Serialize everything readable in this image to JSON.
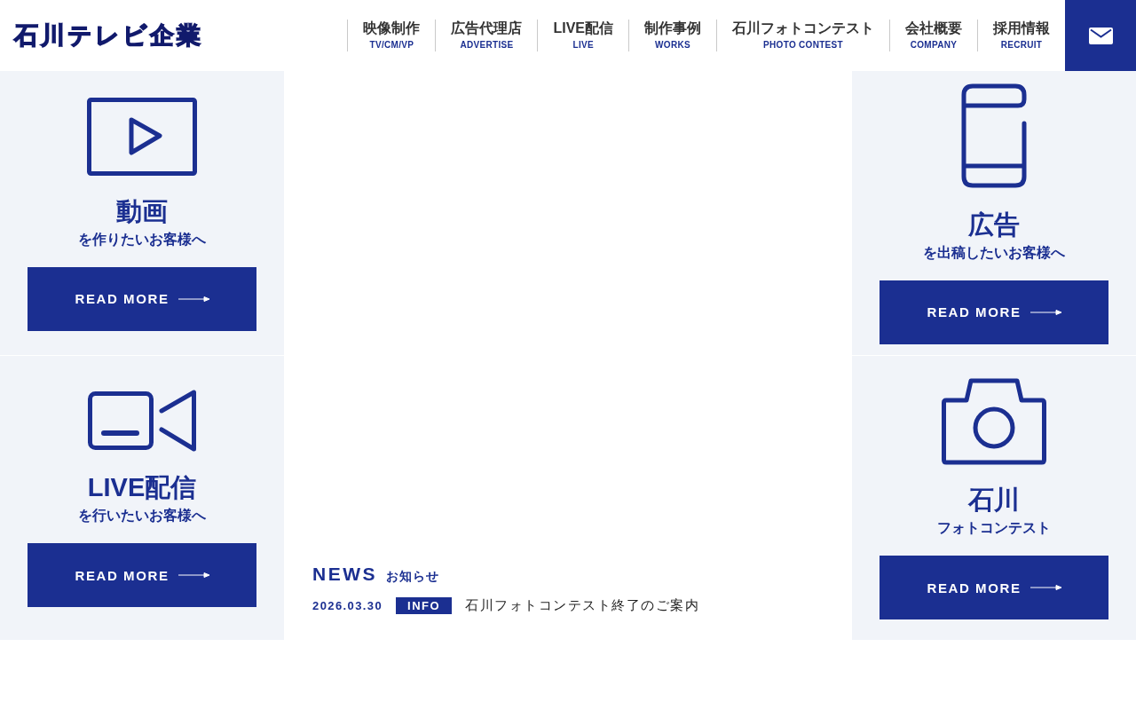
{
  "header": {
    "logo": "石川テレビ企業",
    "nav": [
      {
        "label": "映像制作",
        "sublabel": "TV/CM/VP"
      },
      {
        "label": "広告代理店",
        "sublabel": "ADVERTISE"
      },
      {
        "label": "LIVE配信",
        "sublabel": "LIVE"
      },
      {
        "label": "制作事例",
        "sublabel": "WORKS"
      },
      {
        "label": "石川フォトコンテスト",
        "sublabel": "PHOTO CONTEST"
      },
      {
        "label": "会社概要",
        "sublabel": "COMPANY"
      },
      {
        "label": "採用情報",
        "sublabel": "RECRUIT"
      }
    ]
  },
  "services": [
    {
      "kind": "video",
      "title": "動画",
      "subtitle": "を作りたいお客様へ",
      "button": "READ MORE"
    },
    {
      "kind": "advertising",
      "title": "広告",
      "subtitle": "を出稿したいお客様へ",
      "button": "READ MORE"
    },
    {
      "kind": "live",
      "title": "LIVE配信",
      "subtitle": "を行いたいお客様へ",
      "button": "READ MORE"
    },
    {
      "kind": "photo",
      "title": "石川",
      "subtitle": "フォトコンテスト",
      "button": "READ MORE"
    }
  ],
  "news": {
    "heading": "NEWS",
    "subheading": "お知らせ",
    "items": [
      {
        "date": "2026.03.30",
        "tag": "INFO",
        "title": "石川フォトコンテスト終了のご案内"
      }
    ]
  }
}
